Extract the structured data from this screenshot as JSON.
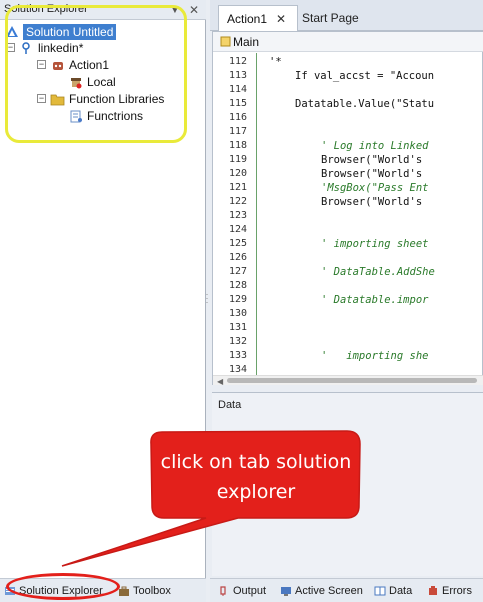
{
  "left_panel": {
    "title": "Solution Explorer",
    "tree": {
      "solution": "Solution Untitled",
      "project": "linkedin*",
      "action": "Action1",
      "local": "Local",
      "function_libraries": "Function Libraries",
      "functions": "Functrions"
    },
    "bottom_tabs": {
      "solution_explorer": "Solution Explorer",
      "toolbox": "Toolbox"
    }
  },
  "editor": {
    "tabs": {
      "action1": "Action1",
      "start_page": "Start Page"
    },
    "breadcrumb": "Main",
    "lines": [
      {
        "n": "112",
        "text": "'*",
        "comment": false
      },
      {
        "n": "113",
        "text": "If val_accst = \"Accoun",
        "comment": false
      },
      {
        "n": "114",
        "text": "",
        "comment": false
      },
      {
        "n": "115",
        "text": "Datatable.Value(\"Statu",
        "comment": false
      },
      {
        "n": "116",
        "text": "",
        "comment": false
      },
      {
        "n": "117",
        "text": "",
        "comment": false
      },
      {
        "n": "118",
        "text": "' Log into Linked",
        "comment": true
      },
      {
        "n": "119",
        "text": "Browser(\"World's ",
        "comment": false
      },
      {
        "n": "120",
        "text": "Browser(\"World's ",
        "comment": false
      },
      {
        "n": "121",
        "text": "'MsgBox(\"Pass Ent",
        "comment": true
      },
      {
        "n": "122",
        "text": "Browser(\"World's ",
        "comment": false
      },
      {
        "n": "123",
        "text": "",
        "comment": false
      },
      {
        "n": "124",
        "text": "",
        "comment": false
      },
      {
        "n": "125",
        "text": "' importing sheet",
        "comment": true
      },
      {
        "n": "126",
        "text": "",
        "comment": false
      },
      {
        "n": "127",
        "text": "' DataTable.AddShe",
        "comment": true
      },
      {
        "n": "128",
        "text": "",
        "comment": false
      },
      {
        "n": "129",
        "text": "' Datatable.impor",
        "comment": true
      },
      {
        "n": "130",
        "text": "",
        "comment": false
      },
      {
        "n": "131",
        "text": "",
        "comment": false
      },
      {
        "n": "132",
        "text": "",
        "comment": false
      },
      {
        "n": "133",
        "text": "'   importing she",
        "comment": true
      },
      {
        "n": "134",
        "text": "",
        "comment": false
      }
    ]
  },
  "data_pane": {
    "title": "Data"
  },
  "bottom_tabs": {
    "output": "Output",
    "active_screen": "Active Screen",
    "data": "Data",
    "errors": "Errors"
  },
  "callout": {
    "text": "click on tab solution explorer"
  },
  "colors": {
    "highlight_yellow": "#e9ea3a",
    "callout_red": "#e3201b",
    "selection_blue": "#3f7fcf",
    "comment_green": "#2a7a2a"
  }
}
